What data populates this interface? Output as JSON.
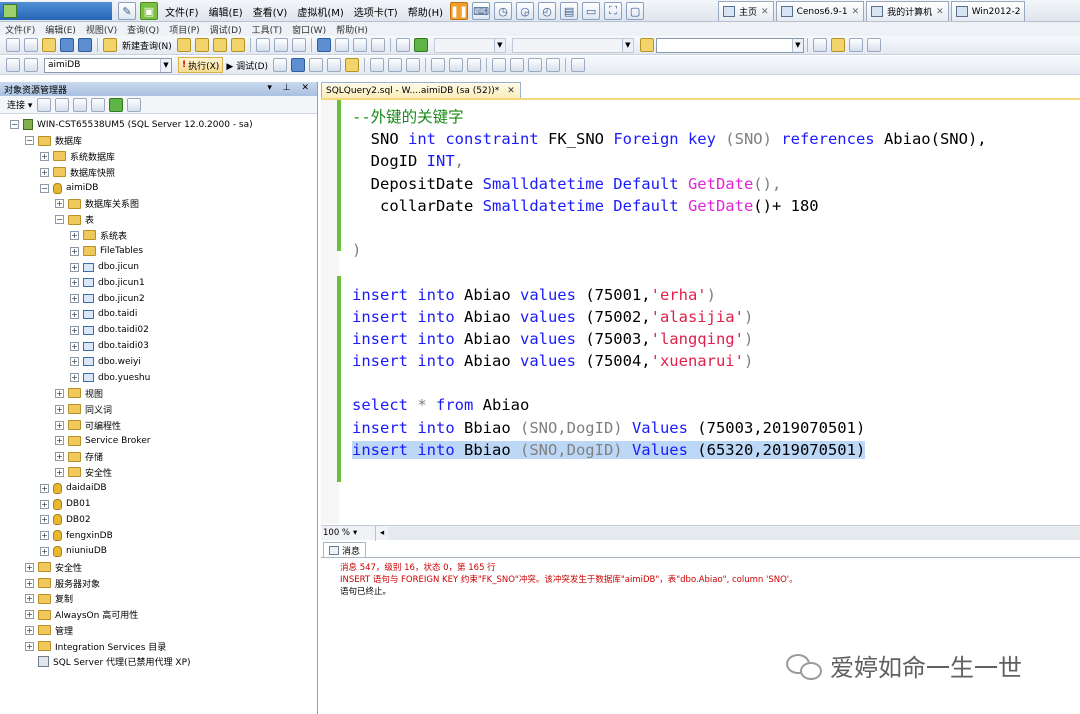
{
  "vm": {
    "menu": [
      "文件(F)",
      "编辑(E)",
      "查看(V)",
      "虚拟机(M)",
      "选项卡(T)",
      "帮助(H)"
    ],
    "tabs": [
      {
        "label": "主页"
      },
      {
        "label": "Cenos6.9-1"
      },
      {
        "label": "我的计算机"
      },
      {
        "label": "Win2012-2"
      }
    ]
  },
  "app_menu": [
    "文件(F)",
    "编辑(E)",
    "视图(V)",
    "查询(Q)",
    "项目(P)",
    "调试(D)",
    "工具(T)",
    "窗口(W)",
    "帮助(H)"
  ],
  "toolbar": {
    "new_query": "新建查询(N)",
    "database_combo": "aimiDB",
    "execute": "执行(X)",
    "debug": "调试(D)"
  },
  "object_explorer": {
    "title": "对象资源管理器",
    "connect": "连接",
    "tree": [
      {
        "label": "WIN-CST65538UM5 (SQL Server 12.0.2000 - sa)",
        "depth": 0,
        "icon": "server",
        "toggle": "−"
      },
      {
        "label": "数据库",
        "depth": 1,
        "icon": "folder",
        "toggle": "−"
      },
      {
        "label": "系统数据库",
        "depth": 2,
        "icon": "folder",
        "toggle": "+"
      },
      {
        "label": "数据库快照",
        "depth": 2,
        "icon": "folder",
        "toggle": "+"
      },
      {
        "label": "aimiDB",
        "depth": 2,
        "icon": "db",
        "toggle": "−"
      },
      {
        "label": "数据库关系图",
        "depth": 3,
        "icon": "folder",
        "toggle": "+"
      },
      {
        "label": "表",
        "depth": 3,
        "icon": "folder",
        "toggle": "−"
      },
      {
        "label": "系统表",
        "depth": 4,
        "icon": "folder",
        "toggle": "+"
      },
      {
        "label": "FileTables",
        "depth": 4,
        "icon": "folder",
        "toggle": "+"
      },
      {
        "label": "dbo.jicun",
        "depth": 4,
        "icon": "table",
        "toggle": "+"
      },
      {
        "label": "dbo.jicun1",
        "depth": 4,
        "icon": "table",
        "toggle": "+"
      },
      {
        "label": "dbo.jicun2",
        "depth": 4,
        "icon": "table",
        "toggle": "+"
      },
      {
        "label": "dbo.taidi",
        "depth": 4,
        "icon": "table",
        "toggle": "+"
      },
      {
        "label": "dbo.taidi02",
        "depth": 4,
        "icon": "table",
        "toggle": "+"
      },
      {
        "label": "dbo.taidi03",
        "depth": 4,
        "icon": "table",
        "toggle": "+"
      },
      {
        "label": "dbo.weiyi",
        "depth": 4,
        "icon": "table",
        "toggle": "+"
      },
      {
        "label": "dbo.yueshu",
        "depth": 4,
        "icon": "table",
        "toggle": "+"
      },
      {
        "label": "视图",
        "depth": 3,
        "icon": "folder",
        "toggle": "+"
      },
      {
        "label": "同义词",
        "depth": 3,
        "icon": "folder",
        "toggle": "+"
      },
      {
        "label": "可编程性",
        "depth": 3,
        "icon": "folder",
        "toggle": "+"
      },
      {
        "label": "Service Broker",
        "depth": 3,
        "icon": "folder",
        "toggle": "+"
      },
      {
        "label": "存储",
        "depth": 3,
        "icon": "folder",
        "toggle": "+"
      },
      {
        "label": "安全性",
        "depth": 3,
        "icon": "folder",
        "toggle": "+"
      },
      {
        "label": "daidaiDB",
        "depth": 2,
        "icon": "db",
        "toggle": "+"
      },
      {
        "label": "DB01",
        "depth": 2,
        "icon": "db",
        "toggle": "+"
      },
      {
        "label": "DB02",
        "depth": 2,
        "icon": "db",
        "toggle": "+"
      },
      {
        "label": "fengxinDB",
        "depth": 2,
        "icon": "db",
        "toggle": "+"
      },
      {
        "label": "niuniuDB",
        "depth": 2,
        "icon": "db",
        "toggle": "+"
      },
      {
        "label": "安全性",
        "depth": 1,
        "icon": "folder",
        "toggle": "+"
      },
      {
        "label": "服务器对象",
        "depth": 1,
        "icon": "folder",
        "toggle": "+"
      },
      {
        "label": "复制",
        "depth": 1,
        "icon": "folder",
        "toggle": "+"
      },
      {
        "label": "AlwaysOn 高可用性",
        "depth": 1,
        "icon": "folder",
        "toggle": "+"
      },
      {
        "label": "管理",
        "depth": 1,
        "icon": "folder",
        "toggle": "+"
      },
      {
        "label": "Integration Services 目录",
        "depth": 1,
        "icon": "folder",
        "toggle": "+"
      },
      {
        "label": "SQL Server 代理(已禁用代理 XP)",
        "depth": 1,
        "icon": "agent",
        "toggle": ""
      }
    ]
  },
  "editor": {
    "tab_label": "SQLQuery2.sql - W....aimiDB (sa (52))*",
    "zoom": "100 %",
    "lines": [
      [
        {
          "t": "--外键的关键字",
          "c": "cm"
        }
      ],
      [
        {
          "t": "  SNO ",
          "c": "pl"
        },
        {
          "t": "int constraint",
          "c": "kw"
        },
        {
          "t": " FK_SNO ",
          "c": "pl"
        },
        {
          "t": "Foreign key",
          "c": "kw"
        },
        {
          "t": " (SNO) ",
          "c": "gr"
        },
        {
          "t": "references",
          "c": "kw"
        },
        {
          "t": " Abiao(SNO),",
          "c": "pl"
        }
      ],
      [
        {
          "t": "  DogID ",
          "c": "pl"
        },
        {
          "t": "INT",
          "c": "kw"
        },
        {
          "t": ",",
          "c": "gr"
        }
      ],
      [
        {
          "t": "  DepositDate ",
          "c": "pl"
        },
        {
          "t": "Smalldatetime Default",
          "c": "kw"
        },
        {
          "t": " ",
          "c": "pl"
        },
        {
          "t": "GetDate",
          "c": "fn"
        },
        {
          "t": "(),",
          "c": "gr"
        }
      ],
      [
        {
          "t": "   collarDate ",
          "c": "pl"
        },
        {
          "t": "Smalldatetime Default",
          "c": "kw"
        },
        {
          "t": " ",
          "c": "pl"
        },
        {
          "t": "GetDate",
          "c": "fn"
        },
        {
          "t": "()+ 180",
          "c": "pl"
        }
      ],
      [
        {
          "t": "",
          "c": "pl"
        }
      ],
      [
        {
          "t": ")",
          "c": "gr"
        }
      ],
      [
        {
          "t": "",
          "c": "pl"
        }
      ],
      [
        {
          "t": "insert into",
          "c": "kw"
        },
        {
          "t": " Abiao ",
          "c": "pl"
        },
        {
          "t": "values",
          "c": "kw"
        },
        {
          "t": " (75001,",
          "c": "pl"
        },
        {
          "t": "'erha'",
          "c": "str"
        },
        {
          "t": ")",
          "c": "gr"
        }
      ],
      [
        {
          "t": "insert into",
          "c": "kw"
        },
        {
          "t": " Abiao ",
          "c": "pl"
        },
        {
          "t": "values",
          "c": "kw"
        },
        {
          "t": " (75002,",
          "c": "pl"
        },
        {
          "t": "'alasijia'",
          "c": "str"
        },
        {
          "t": ")",
          "c": "gr"
        }
      ],
      [
        {
          "t": "insert into",
          "c": "kw"
        },
        {
          "t": " Abiao ",
          "c": "pl"
        },
        {
          "t": "values",
          "c": "kw"
        },
        {
          "t": " (75003,",
          "c": "pl"
        },
        {
          "t": "'langqing'",
          "c": "str"
        },
        {
          "t": ")",
          "c": "gr"
        }
      ],
      [
        {
          "t": "insert into",
          "c": "kw"
        },
        {
          "t": " Abiao ",
          "c": "pl"
        },
        {
          "t": "values",
          "c": "kw"
        },
        {
          "t": " (75004,",
          "c": "pl"
        },
        {
          "t": "'xuenarui'",
          "c": "str"
        },
        {
          "t": ")",
          "c": "gr"
        }
      ],
      [
        {
          "t": "",
          "c": "pl"
        }
      ],
      [
        {
          "t": "select",
          "c": "kw"
        },
        {
          "t": " * ",
          "c": "gr"
        },
        {
          "t": "from",
          "c": "kw"
        },
        {
          "t": " Abiao",
          "c": "pl"
        }
      ],
      [
        {
          "t": "insert into",
          "c": "kw"
        },
        {
          "t": " Bbiao ",
          "c": "pl"
        },
        {
          "t": "(SNO,DogID) ",
          "c": "gr"
        },
        {
          "t": "Values",
          "c": "kw"
        },
        {
          "t": " (75003,2019070501)",
          "c": "pl"
        }
      ],
      [
        {
          "t": "insert into",
          "c": "kw"
        },
        {
          "t": " Bbiao ",
          "c": "pl"
        },
        {
          "t": "(SNO,DogID) ",
          "c": "gr"
        },
        {
          "t": "Values",
          "c": "kw"
        },
        {
          "t": " (65320,2019070501)",
          "c": "pl"
        }
      ]
    ],
    "selected_line": 15
  },
  "results": {
    "tab_label": "消息",
    "messages": [
      {
        "text": "消息 547，级别 16，状态 0，第 165 行",
        "color": "red"
      },
      {
        "text": "INSERT 语句与 FOREIGN KEY 约束\"FK_SNO\"冲突。该冲突发生于数据库\"aimiDB\"，表\"dbo.Abiao\", column 'SNO'。",
        "color": "red"
      },
      {
        "text": "语句已终止。",
        "color": "black"
      }
    ]
  },
  "watermark": "爱婷如命一生一世"
}
